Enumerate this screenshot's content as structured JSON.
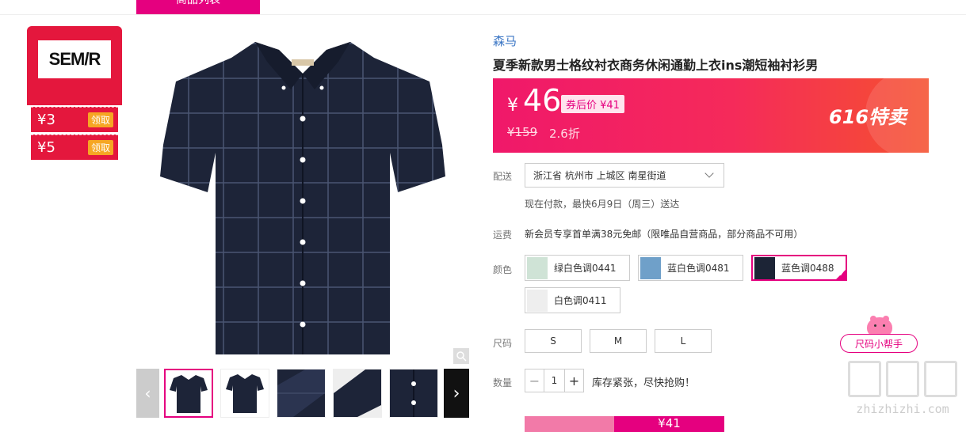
{
  "nav": {
    "active_tab": "商品列表"
  },
  "brand_card": {
    "logo_text": "SEM/R",
    "coupons": [
      {
        "amount": "¥3",
        "claim": "领取"
      },
      {
        "amount": "¥5",
        "claim": "领取"
      }
    ]
  },
  "product": {
    "brand": "森马",
    "title": "夏季新款男士格纹衬衣商务休闲通勤上衣ins潮短袖衬衫男",
    "price_symbol": "¥",
    "price": "46",
    "after_coupon": "券后价 ¥41",
    "original_price": "¥159",
    "discount": "2.6折",
    "promo_tag": "616特卖"
  },
  "delivery": {
    "label": "配送",
    "address": "浙江省 杭州市 上城区 南星街道",
    "note": "现在付款，最快6月9日（周三）送达"
  },
  "shipping": {
    "label": "运费",
    "note": "新会员专享首单满38元免邮（限唯品自营商品，部分商品不可用）"
  },
  "colors": {
    "label": "颜色",
    "options": [
      {
        "name": "绿白色调0441",
        "swatch": "#cfe3d6"
      },
      {
        "name": "蓝白色调0481",
        "swatch": "#6fa0c9"
      },
      {
        "name": "蓝色调0488",
        "swatch": "#1c2436"
      },
      {
        "name": "白色调0411",
        "swatch": "#eeeeee"
      }
    ],
    "selected_index": 2
  },
  "sizes": {
    "label": "尺码",
    "options": [
      "S",
      "M",
      "L"
    ],
    "helper": "尺码小帮手"
  },
  "quantity": {
    "label": "数量",
    "value": "1",
    "minus": "−",
    "plus": "+",
    "stock_note": "库存紧张，尽快抢购！"
  },
  "buy_bar": {
    "right_label": "¥41"
  },
  "watermark": {
    "url": "zhizhizhi.com"
  },
  "thumbnails": {
    "prev": "‹",
    "next": "›"
  },
  "colors_theme": {
    "accent": "#e5007f",
    "price_gradient_start": "#f0186a",
    "price_gradient_end": "#f5512f"
  }
}
